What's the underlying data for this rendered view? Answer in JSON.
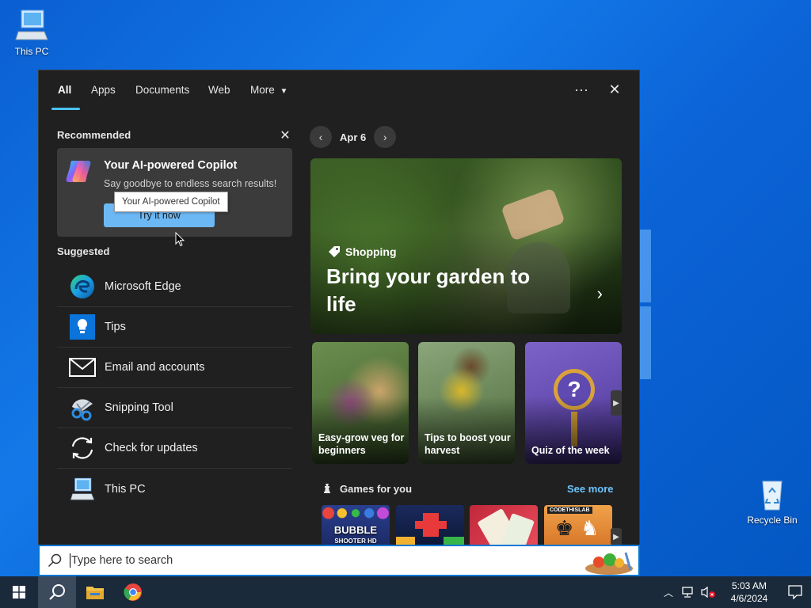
{
  "desktop": {
    "icons": [
      {
        "label": "This PC",
        "icon": "computer-icon"
      },
      {
        "label": "Recycle Bin",
        "icon": "recycle-bin-icon"
      }
    ]
  },
  "search_panel": {
    "tabs": [
      {
        "label": "All",
        "active": true
      },
      {
        "label": "Apps"
      },
      {
        "label": "Documents"
      },
      {
        "label": "Web"
      },
      {
        "label": "More",
        "icon": "caret-down-icon"
      }
    ],
    "more_options_label": "···",
    "close_label": "✕",
    "recommended": {
      "title": "Recommended",
      "card": {
        "title": "Your AI-powered Copilot",
        "subtitle": "Say goodbye to endless search results!",
        "button": "Try it now",
        "tooltip": "Your AI-powered Copilot",
        "icon": "copilot-icon"
      }
    },
    "suggested": {
      "title": "Suggested",
      "items": [
        {
          "label": "Microsoft Edge",
          "icon": "edge-icon"
        },
        {
          "label": "Tips",
          "icon": "tips-icon"
        },
        {
          "label": "Email and accounts",
          "icon": "mail-icon"
        },
        {
          "label": "Snipping Tool",
          "icon": "snipping-tool-icon"
        },
        {
          "label": "Check for updates",
          "icon": "refresh-icon"
        },
        {
          "label": "This PC",
          "icon": "computer-icon"
        }
      ]
    },
    "highlights": {
      "date": "Apr 6",
      "hero": {
        "category": "Shopping",
        "title": "Bring your garden to life"
      },
      "cards": [
        {
          "caption": "Easy-grow veg for beginners"
        },
        {
          "caption": "Tips to boost your harvest"
        },
        {
          "caption": "Quiz of the week"
        }
      ],
      "games": {
        "title": "Games for you",
        "see_more": "See more",
        "tiles": [
          "Bubble Shooter HD",
          "Block puzzle",
          "Mahjong",
          "Chess"
        ],
        "tile_labels": {
          "bubble": "BUBBLE",
          "shooter": "SHOOTER HD",
          "codethis": "CODETHISLAB"
        }
      }
    }
  },
  "search_box": {
    "placeholder": "Type here to search"
  },
  "taskbar": {
    "time": "5:03 AM",
    "date": "4/6/2024"
  },
  "colors": {
    "accent": "#4cc2ff",
    "panel_bg": "#202020",
    "link": "#6cc4ff",
    "taskbar": "#1b2a3a"
  }
}
